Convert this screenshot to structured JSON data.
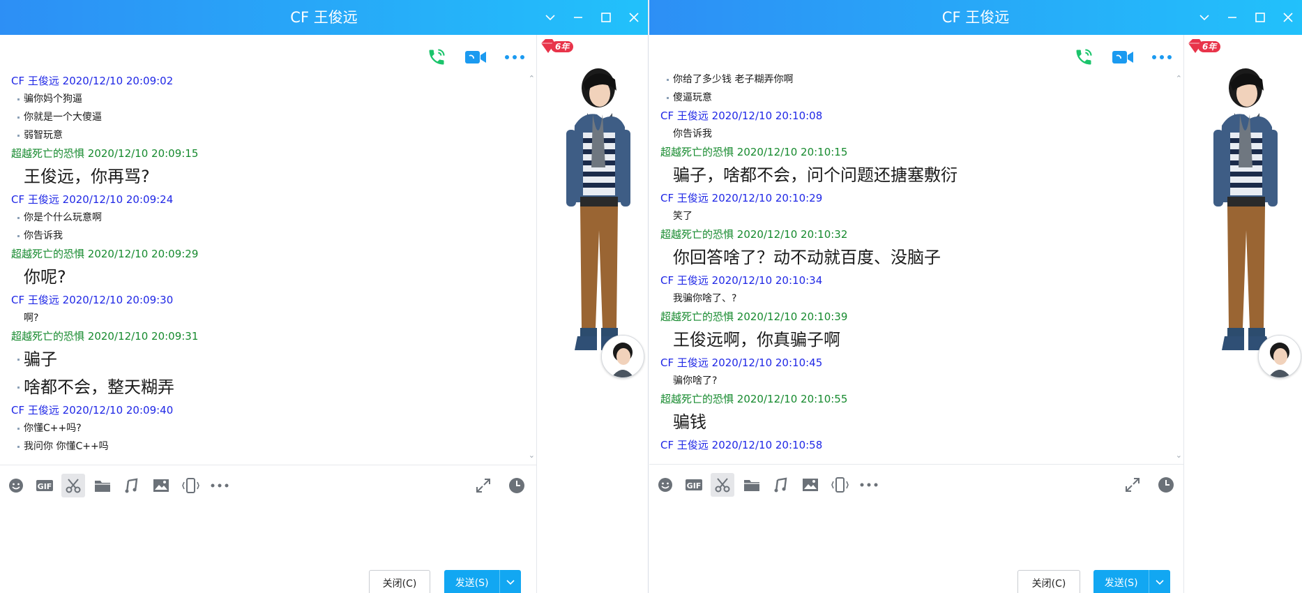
{
  "left": {
    "title": "CF 王俊远",
    "badge": "6年",
    "messages": [
      {
        "sender": "CF 王俊远",
        "time": "2020/12/10 20:09:02",
        "color": "blue",
        "lines": [
          {
            "text": "骗你妈个狗逼",
            "big": false,
            "bullet": true
          },
          {
            "text": "你就是一个大傻逼",
            "big": false,
            "bullet": true
          },
          {
            "text": "弱智玩意",
            "big": false,
            "bullet": true
          }
        ]
      },
      {
        "sender": "超越死亡的恐惧",
        "time": "2020/12/10 20:09:15",
        "color": "green",
        "lines": [
          {
            "text": "王俊远，你再骂?",
            "big": true,
            "bullet": false
          }
        ]
      },
      {
        "sender": "CF 王俊远",
        "time": "2020/12/10 20:09:24",
        "color": "blue",
        "lines": [
          {
            "text": "你是个什么玩意啊",
            "big": false,
            "bullet": true
          },
          {
            "text": "你告诉我",
            "big": false,
            "bullet": true
          }
        ]
      },
      {
        "sender": "超越死亡的恐惧",
        "time": "2020/12/10 20:09:29",
        "color": "green",
        "lines": [
          {
            "text": "你呢?",
            "big": true,
            "bullet": false
          }
        ]
      },
      {
        "sender": "CF 王俊远",
        "time": "2020/12/10 20:09:30",
        "color": "blue",
        "lines": [
          {
            "text": "啊?",
            "big": false,
            "bullet": false
          }
        ]
      },
      {
        "sender": "超越死亡的恐惧",
        "time": "2020/12/10 20:09:31",
        "color": "green",
        "lines": [
          {
            "text": "骗子",
            "big": true,
            "bullet": true
          },
          {
            "text": "啥都不会，整天糊弄",
            "big": true,
            "bullet": true
          }
        ]
      },
      {
        "sender": "CF 王俊远",
        "time": "2020/12/10 20:09:40",
        "color": "blue",
        "lines": [
          {
            "text": "你懂C++吗?",
            "big": false,
            "bullet": true
          },
          {
            "text": "我问你  你懂C++吗",
            "big": false,
            "bullet": true
          }
        ]
      }
    ],
    "close_label": "关闭(C)",
    "send_label": "发送(S)"
  },
  "right": {
    "title": "CF 王俊远",
    "badge": "6年",
    "messages": [
      {
        "sender": "",
        "time": "",
        "color": "blue",
        "lines": [
          {
            "text": "你给了多少钱 老子糊弄你啊",
            "big": false,
            "bullet": true
          },
          {
            "text": "傻逼玩意",
            "big": false,
            "bullet": true
          }
        ]
      },
      {
        "sender": "CF 王俊远",
        "time": "2020/12/10 20:10:08",
        "color": "blue",
        "lines": [
          {
            "text": "你告诉我",
            "big": false,
            "bullet": false
          }
        ]
      },
      {
        "sender": "超越死亡的恐惧",
        "time": "2020/12/10 20:10:15",
        "color": "green",
        "lines": [
          {
            "text": "骗子，啥都不会，问个问题还搪塞敷衍",
            "big": true,
            "bullet": false
          }
        ]
      },
      {
        "sender": "CF 王俊远",
        "time": "2020/12/10 20:10:29",
        "color": "blue",
        "lines": [
          {
            "text": "笑了",
            "big": false,
            "bullet": false
          }
        ]
      },
      {
        "sender": "超越死亡的恐惧",
        "time": "2020/12/10 20:10:32",
        "color": "green",
        "lines": [
          {
            "text": "你回答啥了？动不动就百度、没脑子",
            "big": true,
            "bullet": false
          }
        ]
      },
      {
        "sender": "CF 王俊远",
        "time": "2020/12/10 20:10:34",
        "color": "blue",
        "lines": [
          {
            "text": "我骗你啥了、?",
            "big": false,
            "bullet": false
          }
        ]
      },
      {
        "sender": "超越死亡的恐惧",
        "time": "2020/12/10 20:10:39",
        "color": "green",
        "lines": [
          {
            "text": "王俊远啊，你真骗子啊",
            "big": true,
            "bullet": false
          }
        ]
      },
      {
        "sender": "CF 王俊远",
        "time": "2020/12/10 20:10:45",
        "color": "blue",
        "lines": [
          {
            "text": "骗你啥了?",
            "big": false,
            "bullet": false
          }
        ]
      },
      {
        "sender": "超越死亡的恐惧",
        "time": "2020/12/10 20:10:55",
        "color": "green",
        "lines": [
          {
            "text": "骗钱",
            "big": true,
            "bullet": false
          }
        ]
      },
      {
        "sender": "CF 王俊远",
        "time": "2020/12/10 20:10:58",
        "color": "blue",
        "lines": []
      }
    ],
    "close_label": "关闭(C)",
    "send_label": "发送(S)"
  },
  "toolbar_icons": [
    "emoji-icon",
    "gif-icon",
    "scissors-icon",
    "folder-icon",
    "music-icon",
    "image-icon",
    "shake-icon",
    "more-icon",
    "expand-icon",
    "history-icon"
  ],
  "colors": {
    "titlebar_start": "#2d8ff5",
    "titlebar_end": "#22c1fb",
    "sender_blue": "#1f27e6",
    "sender_green": "#168a2e",
    "send_button": "#12a7f2",
    "call_green": "#1bc46b",
    "video_blue": "#1b9af0"
  }
}
